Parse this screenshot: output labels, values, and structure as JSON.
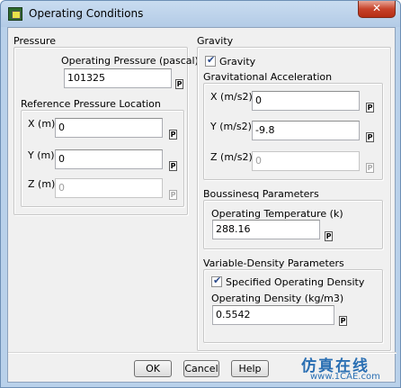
{
  "window": {
    "title": "Operating Conditions",
    "close_glyph": "✕"
  },
  "pressure": {
    "group_label": "Pressure",
    "operating_label": "Operating Pressure (pascal)",
    "operating_value": "101325",
    "ref_location_label": "Reference Pressure Location",
    "x_label": "X (m)",
    "x_value": "0",
    "y_label": "Y (m)",
    "y_value": "0",
    "z_label": "Z (m)",
    "z_value": "0"
  },
  "gravity": {
    "group_label": "Gravity",
    "checkbox_label": "Gravity",
    "checked": true,
    "accel_label": "Gravitational Acceleration",
    "x_label": "X (m/s2)",
    "x_value": "0",
    "y_label": "Y (m/s2)",
    "y_value": "-9.8",
    "z_label": "Z (m/s2)",
    "z_value": "0"
  },
  "boussinesq": {
    "label": "Boussinesq Parameters",
    "temp_label": "Operating Temperature (k)",
    "temp_value": "288.16"
  },
  "variable_density": {
    "label": "Variable-Density Parameters",
    "checkbox_label": "Specified Operating Density",
    "checked": true,
    "density_label": "Operating Density (kg/m3)",
    "density_value": "0.5542"
  },
  "param_glyph": "P",
  "buttons": {
    "ok": "OK",
    "cancel": "Cancel",
    "help": "Help"
  },
  "watermark": {
    "cn": "仿真在线",
    "url": "www.1CAE.com"
  }
}
